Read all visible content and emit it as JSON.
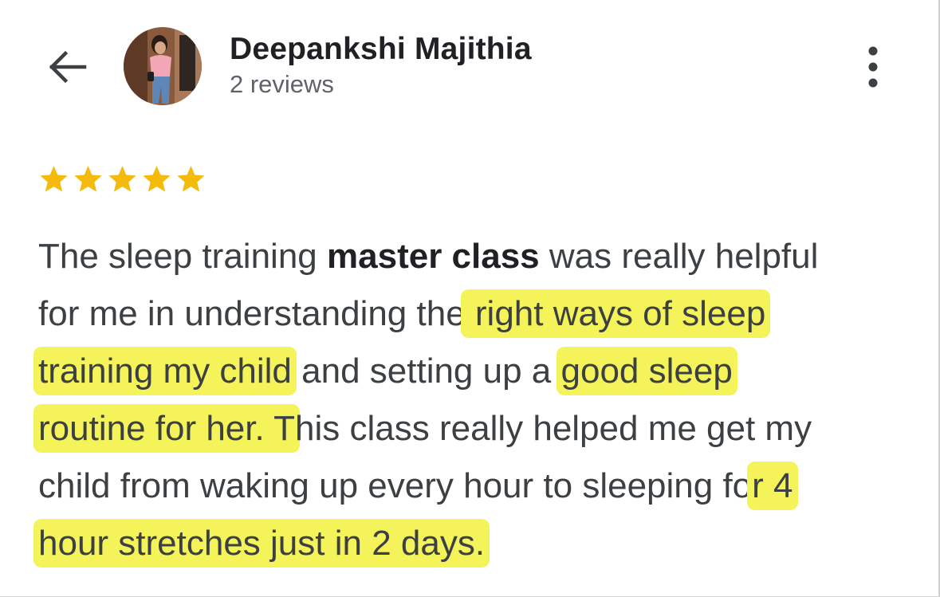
{
  "header": {
    "back_icon": "arrow-left-icon",
    "reviewer_name": "Deepankshi Majithia",
    "review_count": "2 reviews",
    "more_icon": "more-vert-icon"
  },
  "review": {
    "rating": 5,
    "rating_max": 5,
    "star_color": "#f5bb0c",
    "highlight_color": "#f4f35a",
    "lines": [
      {
        "a": "The sleep training ",
        "b": "master class",
        "c": " was really helpful"
      },
      {
        "a": "for me in understanding the",
        "h": " right ways of sleep"
      },
      {
        "h": "training my child",
        "a": " and setting up a ",
        "h2": "good sleep"
      },
      {
        "h": "routine for her. T",
        "a": "his class really helped me get my"
      },
      {
        "a": "child from waking up every hour to sleeping fo",
        "h": "r 4"
      },
      {
        "h": "hour stretches just in 2 days."
      }
    ]
  }
}
